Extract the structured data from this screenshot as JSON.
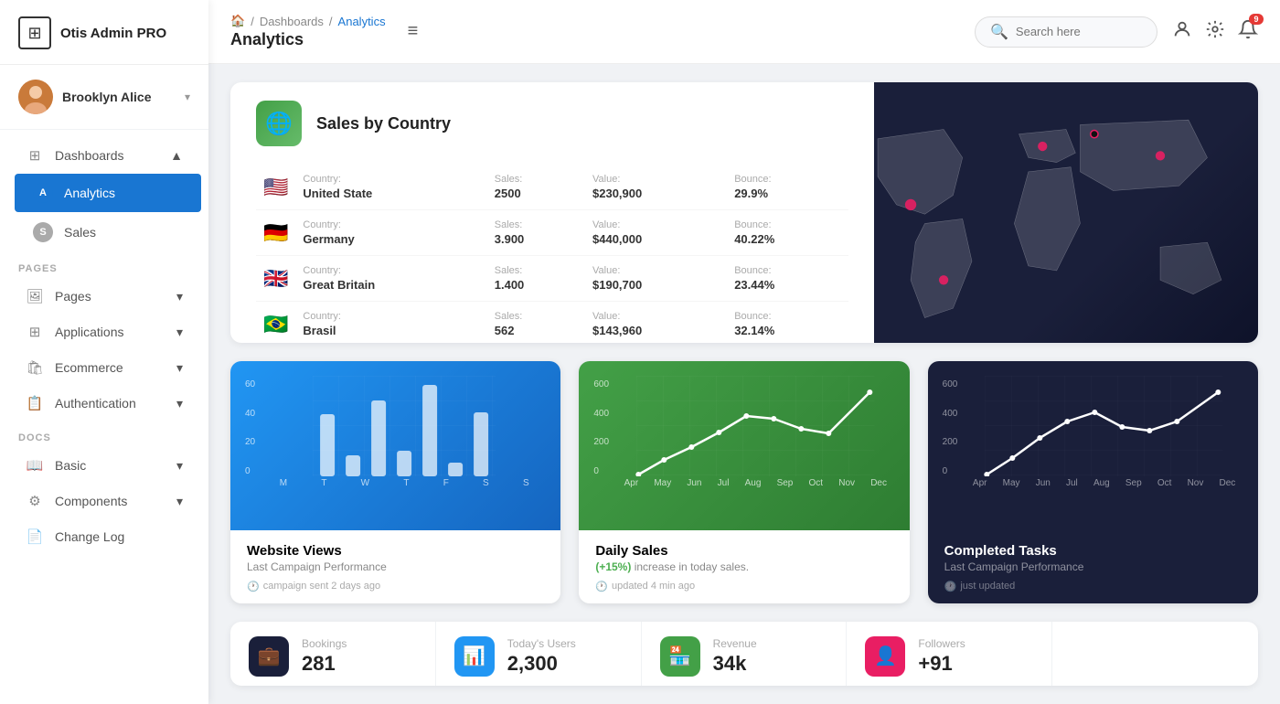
{
  "sidebar": {
    "logo": "Otis Admin PRO",
    "logo_icon": "⊞",
    "user": {
      "name": "Brooklyn Alice",
      "chevron": "▾"
    },
    "nav": {
      "dashboards_label": "Dashboards",
      "analytics_label": "Analytics",
      "sales_label": "Sales",
      "sections": [
        {
          "label": "PAGES",
          "items": [
            {
              "id": "pages",
              "label": "Pages",
              "icon": "🖼"
            },
            {
              "id": "applications",
              "label": "Applications",
              "icon": "⚙"
            },
            {
              "id": "ecommerce",
              "label": "Ecommerce",
              "icon": "🛍"
            },
            {
              "id": "authentication",
              "label": "Authentication",
              "icon": "📋"
            }
          ]
        },
        {
          "label": "DOCS",
          "items": [
            {
              "id": "basic",
              "label": "Basic",
              "icon": "📖"
            },
            {
              "id": "components",
              "label": "Components",
              "icon": "⚙"
            },
            {
              "id": "changelog",
              "label": "Change Log",
              "icon": "📄"
            }
          ]
        }
      ]
    }
  },
  "topbar": {
    "breadcrumb": {
      "home": "🏠",
      "dashboards": "Dashboards",
      "current": "Analytics"
    },
    "page_title": "Analytics",
    "menu_icon": "≡",
    "search_placeholder": "Search here",
    "notification_count": "9"
  },
  "sales_by_country": {
    "title": "Sales by Country",
    "countries": [
      {
        "flag": "🇺🇸",
        "country_label": "Country:",
        "country": "United State",
        "sales_label": "Sales:",
        "sales": "2500",
        "value_label": "Value:",
        "value": "$230,900",
        "bounce_label": "Bounce:",
        "bounce": "29.9%"
      },
      {
        "flag": "🇩🇪",
        "country_label": "Country:",
        "country": "Germany",
        "sales_label": "Sales:",
        "sales": "3.900",
        "value_label": "Value:",
        "value": "$440,000",
        "bounce_label": "Bounce:",
        "bounce": "40.22%"
      },
      {
        "flag": "🇬🇧",
        "country_label": "Country:",
        "country": "Great Britain",
        "sales_label": "Sales:",
        "sales": "1.400",
        "value_label": "Value:",
        "value": "$190,700",
        "bounce_label": "Bounce:",
        "bounce": "23.44%"
      },
      {
        "flag": "🇧🇷",
        "country_label": "Country:",
        "country": "Brasil",
        "sales_label": "Sales:",
        "sales": "562",
        "value_label": "Value:",
        "value": "$143,960",
        "bounce_label": "Bounce:",
        "bounce": "32.14%"
      }
    ]
  },
  "charts": {
    "website_views": {
      "title": "Website Views",
      "subtitle": "Last Campaign Performance",
      "meta": "campaign sent 2 days ago",
      "y_labels": [
        "60",
        "40",
        "20",
        "0"
      ],
      "x_labels": [
        "M",
        "T",
        "W",
        "T",
        "F",
        "S",
        "S"
      ],
      "bars": [
        35,
        12,
        45,
        15,
        60,
        10,
        42
      ]
    },
    "daily_sales": {
      "title": "Daily Sales",
      "subtitle_prefix": "(+15%)",
      "subtitle_suffix": "increase in today sales.",
      "meta": "updated 4 min ago",
      "y_labels": [
        "600",
        "400",
        "200",
        "0"
      ],
      "x_labels": [
        "Apr",
        "May",
        "Jun",
        "Jul",
        "Aug",
        "Sep",
        "Oct",
        "Nov",
        "Dec"
      ],
      "points": [
        10,
        80,
        160,
        280,
        400,
        380,
        300,
        260,
        500
      ]
    },
    "completed_tasks": {
      "title": "Completed Tasks",
      "subtitle": "Last Campaign Performance",
      "meta": "just updated",
      "y_labels": [
        "600",
        "400",
        "200",
        "0"
      ],
      "x_labels": [
        "Apr",
        "May",
        "Jun",
        "Jul",
        "Aug",
        "Sep",
        "Oct",
        "Nov",
        "Dec"
      ],
      "points": [
        20,
        100,
        240,
        360,
        420,
        300,
        280,
        350,
        500
      ]
    }
  },
  "stats": [
    {
      "id": "bookings",
      "icon": "💼",
      "color": "dark",
      "label": "Bookings",
      "value": "281"
    },
    {
      "id": "today-users",
      "icon": "📊",
      "color": "blue",
      "label": "Today's Users",
      "value": "2,300"
    },
    {
      "id": "revenue",
      "icon": "🏪",
      "color": "green",
      "label": "Revenue",
      "value": "34k"
    },
    {
      "id": "followers",
      "icon": "👤",
      "color": "pink",
      "label": "Followers",
      "value": "+91"
    }
  ]
}
